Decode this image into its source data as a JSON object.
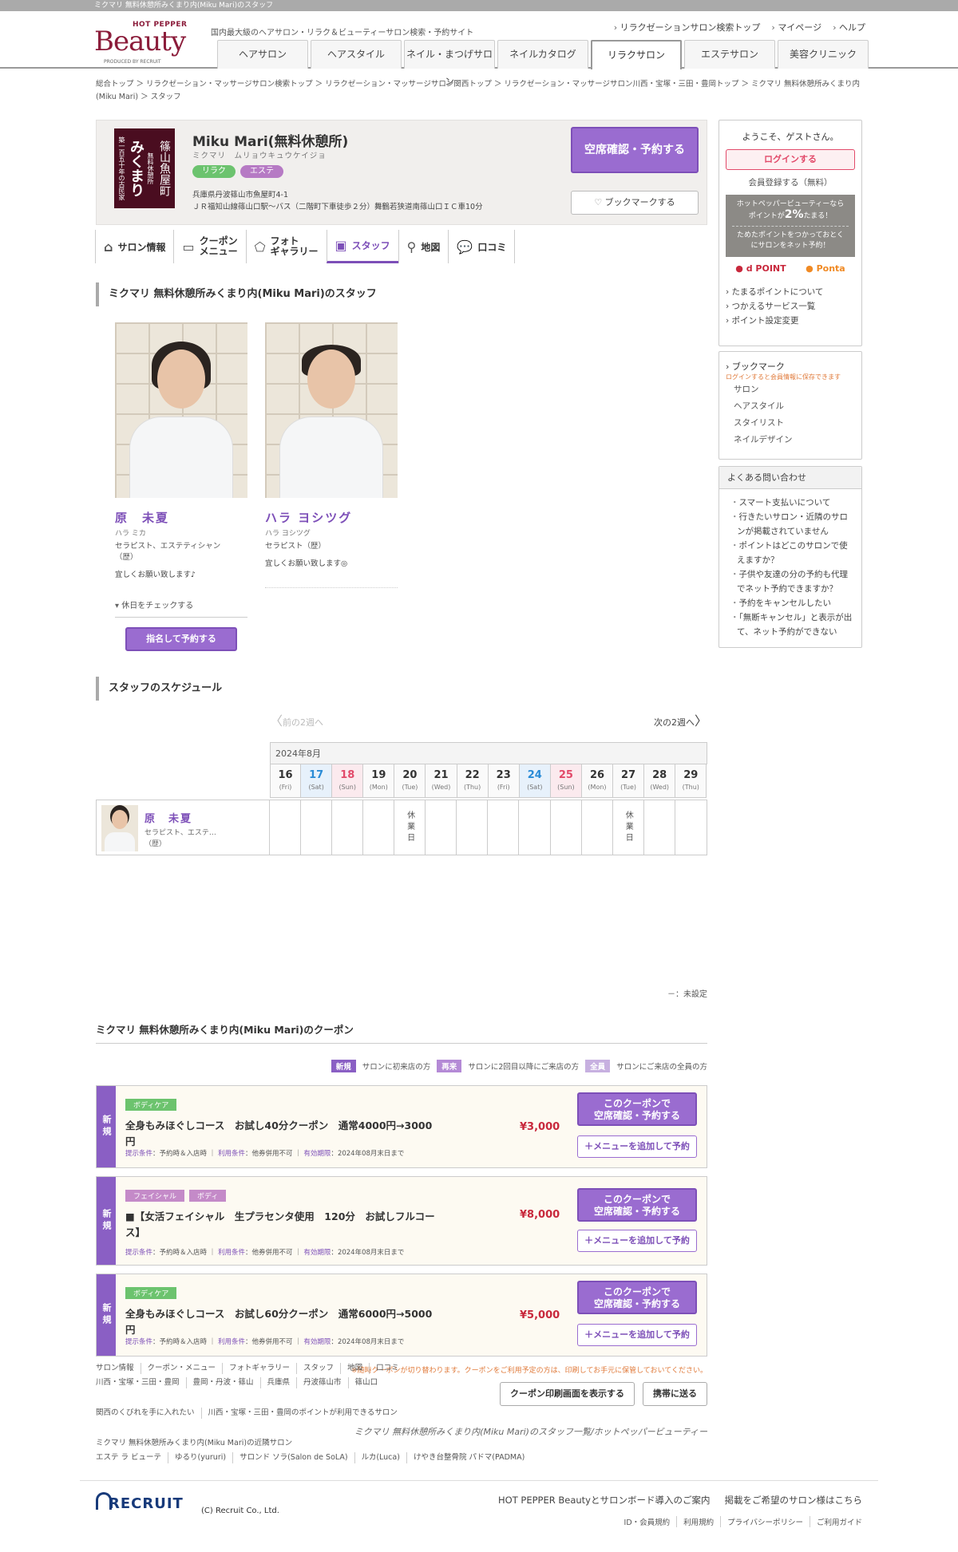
{
  "window_title": "ミクマリ 無料休憩所みくまり内(Miku Mari)のスタッフ",
  "header": {
    "logo_hot_pepper": "HOT PEPPER",
    "logo_beauty": "Beauty",
    "logo_produced": "PRODUCED BY RECRUIT",
    "tagline": "国内最大級のヘアサロン・リラク＆ビューティーサロン検索・予約サイト",
    "top_links": [
      "リラクゼーションサロン検索トップ",
      "マイページ",
      "ヘルプ"
    ],
    "nav": [
      "ヘアサロン",
      "ヘアスタイル",
      "ネイル・まつげサロン",
      "ネイルカタログ",
      "リラクサロン",
      "エステサロン",
      "美容クリニック"
    ],
    "nav_active_index": 4
  },
  "breadcrumb": "総合トップ ＞ リラクゼーション・マッサージサロン検索トップ ＞ リラクゼーション・マッサージサロン関西トップ ＞ リラクゼーション・マッサージサロン川西・宝塚・三田・豊岡トップ ＞ ミクマリ 無料休憩所みくまり内(Miku Mari) ＞ スタッフ",
  "salon": {
    "logo_text_main": "みくまり",
    "logo_text_sub": "篠山魚屋町",
    "logo_text_side": "築一百五十年の古民家",
    "logo_text_small": "無料休憩所",
    "name": "Miku Mari(無料休憩所)",
    "kana": "ミクマリ　ムリョウキュウケイジョ",
    "tags": [
      {
        "label": "リラク",
        "color": "#6cc36e"
      },
      {
        "label": "エステ",
        "color": "#b67ac4"
      }
    ],
    "address": "兵庫県丹波篠山市魚屋町4-1",
    "access": "ＪＲ福知山線篠山口駅～バス（二階町下車徒歩２分）舞鶴若狭道南篠山口ＩＣ車10分",
    "book_label": "空席確認・予約する",
    "bookmark_label": "ブックマークする"
  },
  "tabs": [
    {
      "label": "サロン情報",
      "icon": "house-icon"
    },
    {
      "label": "クーポン\nメニュー",
      "icon": "ticket-icon"
    },
    {
      "label": "フォト\nギャラリー",
      "icon": "gallery-icon"
    },
    {
      "label": "スタッフ",
      "icon": "staff-card-icon"
    },
    {
      "label": "地図",
      "icon": "map-pin-icon"
    },
    {
      "label": "口コミ",
      "icon": "speech-bubble-icon"
    }
  ],
  "tabs_active_index": 3,
  "staff_section_title": "ミクマリ 無料休憩所みくまり内(Miku Mari)のスタッフ",
  "staff": [
    {
      "name": "原　未夏",
      "kana": "ハラ ミカ",
      "role": "セラピスト、エステティシャン",
      "years": "（歴）",
      "message": "宜しくお願い致します♪",
      "holiday_label": "休日をチェックする",
      "reserve_label": "指名して予約する"
    },
    {
      "name": "ハラ ヨシツグ",
      "kana": "ハラ ヨシツグ",
      "role": "セラピスト（歴）",
      "message": "宜しくお願い致します◎"
    }
  ],
  "schedule": {
    "title": "スタッフのスケジュール",
    "prev_label": "前の2週へ",
    "next_label": "次の2週へ",
    "month": "2024年8月",
    "days": [
      {
        "d": "16",
        "w": "(Fri)",
        "t": ""
      },
      {
        "d": "17",
        "w": "(Sat)",
        "t": "sat"
      },
      {
        "d": "18",
        "w": "(Sun)",
        "t": "sun"
      },
      {
        "d": "19",
        "w": "(Mon)",
        "t": ""
      },
      {
        "d": "20",
        "w": "(Tue)",
        "t": ""
      },
      {
        "d": "21",
        "w": "(Wed)",
        "t": ""
      },
      {
        "d": "22",
        "w": "(Thu)",
        "t": ""
      },
      {
        "d": "23",
        "w": "(Fri)",
        "t": ""
      },
      {
        "d": "24",
        "w": "(Sat)",
        "t": "sat"
      },
      {
        "d": "25",
        "w": "(Sun)",
        "t": "sun"
      },
      {
        "d": "26",
        "w": "(Mon)",
        "t": ""
      },
      {
        "d": "27",
        "w": "(Tue)",
        "t": ""
      },
      {
        "d": "28",
        "w": "(Wed)",
        "t": ""
      },
      {
        "d": "29",
        "w": "(Thu)",
        "t": ""
      }
    ],
    "staff_row": {
      "name": "原　未夏",
      "role": "セラピスト、エステ…",
      "years": "（歴）",
      "cells": [
        "",
        "",
        "",
        "",
        "休業日",
        "",
        "",
        "",
        "",
        "",
        "",
        "休業日",
        "",
        ""
      ]
    },
    "legend": "－：未設定"
  },
  "coupons": {
    "title": "ミクマリ 無料休憩所みくまり内(Miku Mari)のクーポン",
    "legend": [
      {
        "label": "新規",
        "text": "サロンに初来店の方",
        "color": "#8a5fc4"
      },
      {
        "label": "再来",
        "text": "サロンに2回目以降にご来店の方",
        "color": "#b48ad6"
      },
      {
        "label": "全員",
        "text": "サロンにご来店の全員の方",
        "color": "#c7b0e0"
      }
    ],
    "items": [
      {
        "type": "新規",
        "tags": [
          {
            "label": "ボディケア",
            "color": "#6cc36e"
          }
        ],
        "title": "全身もみほぐしコース　お試し40分クーポン　通常4000円→3000円",
        "price": "¥3,000",
        "cond_present_label": "提示条件",
        "cond_present": "予約時＆入店時",
        "cond_use_label": "利用条件",
        "cond_use": "他券併用不可",
        "cond_expire_label": "有効期限",
        "cond_expire": "2024年08月末日まで",
        "btn_book": "このクーポンで\n空席確認・予約する",
        "btn_add": "＋メニューを追加して予約"
      },
      {
        "type": "新規",
        "tags": [
          {
            "label": "フェイシャル",
            "color": "#c48ac8"
          },
          {
            "label": "ボディ",
            "color": "#c48ac8"
          }
        ],
        "title": "■【女活フェイシャル　生プラセンタ使用　120分　お試しフルコース】",
        "price": "¥8,000",
        "cond_present_label": "提示条件",
        "cond_present": "予約時＆入店時",
        "cond_use_label": "利用条件",
        "cond_use": "他券併用不可",
        "cond_expire_label": "有効期限",
        "cond_expire": "2024年08月末日まで",
        "btn_book": "このクーポンで\n空席確認・予約する",
        "btn_add": "＋メニューを追加して予約"
      },
      {
        "type": "新規",
        "tags": [
          {
            "label": "ボディケア",
            "color": "#6cc36e"
          }
        ],
        "title": "全身もみほぐしコース　お試し60分クーポン　通常6000円→5000円",
        "price": "¥5,000",
        "cond_present_label": "提示条件",
        "cond_present": "予約時＆入店時",
        "cond_use_label": "利用条件",
        "cond_use": "他券併用不可",
        "cond_expire_label": "有効期限",
        "cond_expire": "2024年08月末日まで",
        "btn_book": "このクーポンで\n空席確認・予約する",
        "btn_add": "＋メニューを追加して予約"
      }
    ],
    "note": "※随時クーポンが切り替わります。クーポンをご利用予定の方は、印刷してお手元に保管しておいてください。",
    "print_label": "クーポン印刷画面を表示する",
    "mobile_label": "携帯に送る"
  },
  "page_footer_title": "ミクマリ 無料休憩所みくまり内(Miku Mari)のスタッフ一覧/ホットペッパービューティー",
  "sidebar": {
    "welcome": "ようこそ、ゲストさん。",
    "login": "ログインする",
    "register": "会員登録する（無料）",
    "promo_line1": "ホットペッパービューティーなら",
    "promo_line2_pre": "ポイントが",
    "promo_pct": "2%",
    "promo_line2_post": "たまる！",
    "promo_line3": "ためたポイントをつかっておとく",
    "promo_line4": "にサロンをネット予約！",
    "point_logos": [
      "d POINT",
      "Ponta"
    ],
    "point_links": [
      "たまるポイントについて",
      "つかえるサービス一覧",
      "ポイント設定変更"
    ],
    "bookmark_title": "ブックマーク",
    "bookmark_note": "ログインすると会員情報に保存できます",
    "bookmark_items": [
      "サロン",
      "ヘアスタイル",
      "スタイリスト",
      "ネイルデザイン"
    ],
    "faq_title": "よくある問い合わせ",
    "faq": [
      "スマート支払いについて",
      "行きたいサロン・近隣のサロンが掲載されていません",
      "ポイントはどこのサロンで使えますか？",
      "子供や友達の分の予約も代理でネット予約できますか？",
      "予約をキャンセルしたい",
      "「無断キャンセル」と表示が出て、ネット予約ができない"
    ]
  },
  "footer": {
    "nav1": [
      "サロン情報",
      "クーポン・メニュー",
      "フォトギャラリー",
      "スタッフ",
      "地図",
      "口コミ"
    ],
    "nav2": [
      "川西・宝塚・三田・豊岡",
      "豊岡・丹波・篠山",
      "兵庫県",
      "丹波篠山市",
      "篠山口"
    ],
    "nav3": [
      "関西のくびれを手に入れたい",
      "川西・宝塚・三田・豊岡のポイントが利用できるサロン"
    ],
    "nearby_title": "ミクマリ 無料休憩所みくまり内(Miku Mari)の近隣サロン",
    "nearby": [
      "エステ ラ ビューテ",
      "ゆるり(yururi)",
      "サロンド ソラ(Salon de SoLA)",
      "ルカ(Luca)",
      "けやき台整骨院 パドマ(PADMA)"
    ],
    "recruit": "RECRUIT",
    "copyright": "(C) Recruit Co., Ltd.",
    "links": [
      "HOT PEPPER Beautyとサロンボード導入のご案内",
      "掲載をご希望のサロン様はこちら"
    ],
    "links2": [
      "ID・会員規約",
      "利用規約",
      "プライバシーポリシー",
      "ご利用ガイド"
    ]
  }
}
